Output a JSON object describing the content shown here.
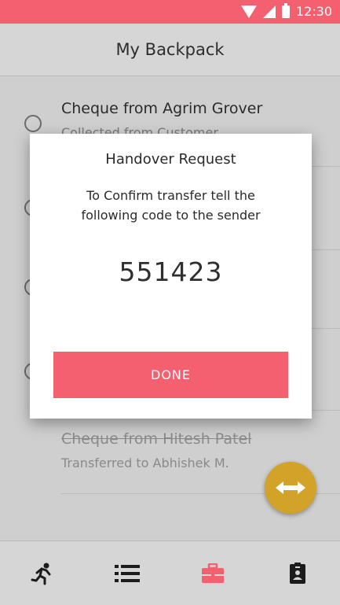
{
  "status_bar": {
    "time": "12:30"
  },
  "app_bar": {
    "title": "My Backpack"
  },
  "list": {
    "items": [
      {
        "title": "Cheque from Agrim Grover",
        "subtitle": "Collected from Customer"
      },
      {
        "title": "",
        "subtitle": ""
      },
      {
        "title": "",
        "subtitle": ""
      },
      {
        "title": "",
        "subtitle": ""
      },
      {
        "title": "Cheque from Hitesh Patel",
        "subtitle": "Transferred to Abhishek M."
      }
    ]
  },
  "dialog": {
    "title": "Handover Request",
    "message": "To Confirm transfer tell the following code to the sender",
    "code": "551423",
    "button_label": "DONE"
  },
  "fab": {
    "icon": "swap-icon"
  },
  "bottom_nav": {
    "items": [
      {
        "icon": "runner-icon",
        "active": false
      },
      {
        "icon": "list-icon",
        "active": false
      },
      {
        "icon": "briefcase-icon",
        "active": true
      },
      {
        "icon": "id-badge-icon",
        "active": false
      }
    ],
    "active_color": "#f4606f",
    "inactive_color": "#1c1c1c"
  },
  "colors": {
    "accent": "#f4606f",
    "fab": "#d2a229"
  }
}
